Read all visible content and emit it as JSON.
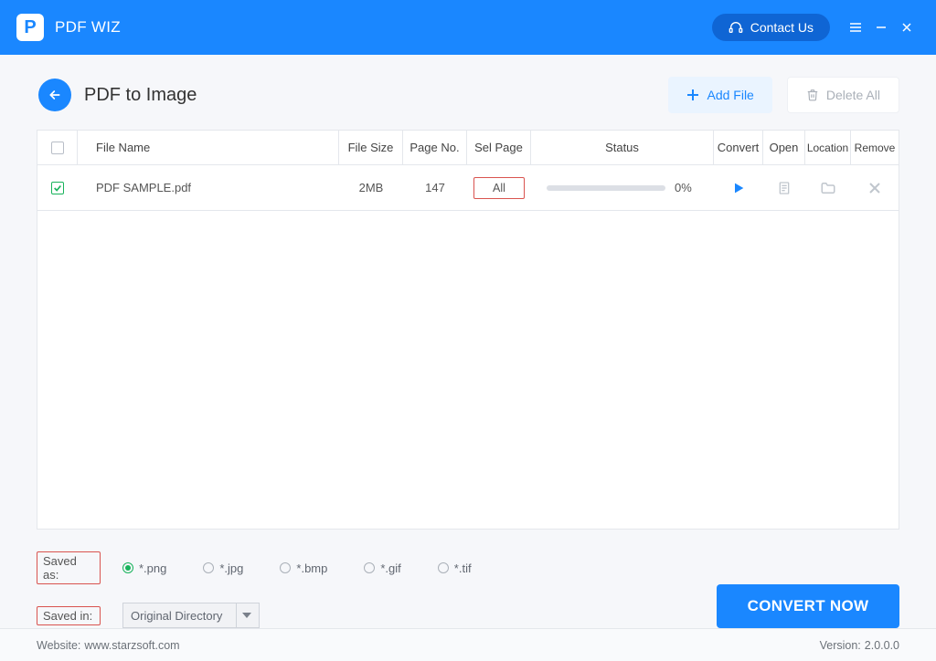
{
  "titlebar": {
    "app_name": "PDF WIZ",
    "contact_label": "Contact Us"
  },
  "toolbar": {
    "page_title": "PDF to Image",
    "add_file_label": "Add File",
    "delete_all_label": "Delete All"
  },
  "table": {
    "headers": {
      "file_name": "File Name",
      "file_size": "File Size",
      "page_no": "Page No.",
      "sel_page": "Sel Page",
      "status": "Status",
      "convert": "Convert",
      "open": "Open",
      "location": "Location",
      "remove": "Remove"
    },
    "rows": [
      {
        "checked": true,
        "file_name": "PDF SAMPLE.pdf",
        "file_size": "2MB",
        "page_no": "147",
        "sel_page": "All",
        "progress_percent": "0%"
      }
    ]
  },
  "footer": {
    "saved_as_label": "Saved as:",
    "formats": [
      "*.png",
      "*.jpg",
      "*.bmp",
      "*.gif",
      "*.tif"
    ],
    "saved_in_label": "Saved in:",
    "saved_in_value": "Original Directory",
    "convert_now_label": "CONVERT NOW"
  },
  "statusbar": {
    "website_label": "Website:",
    "website_value": "www.starzsoft.com",
    "version_label": "Version:",
    "version_value": "2.0.0.0"
  }
}
